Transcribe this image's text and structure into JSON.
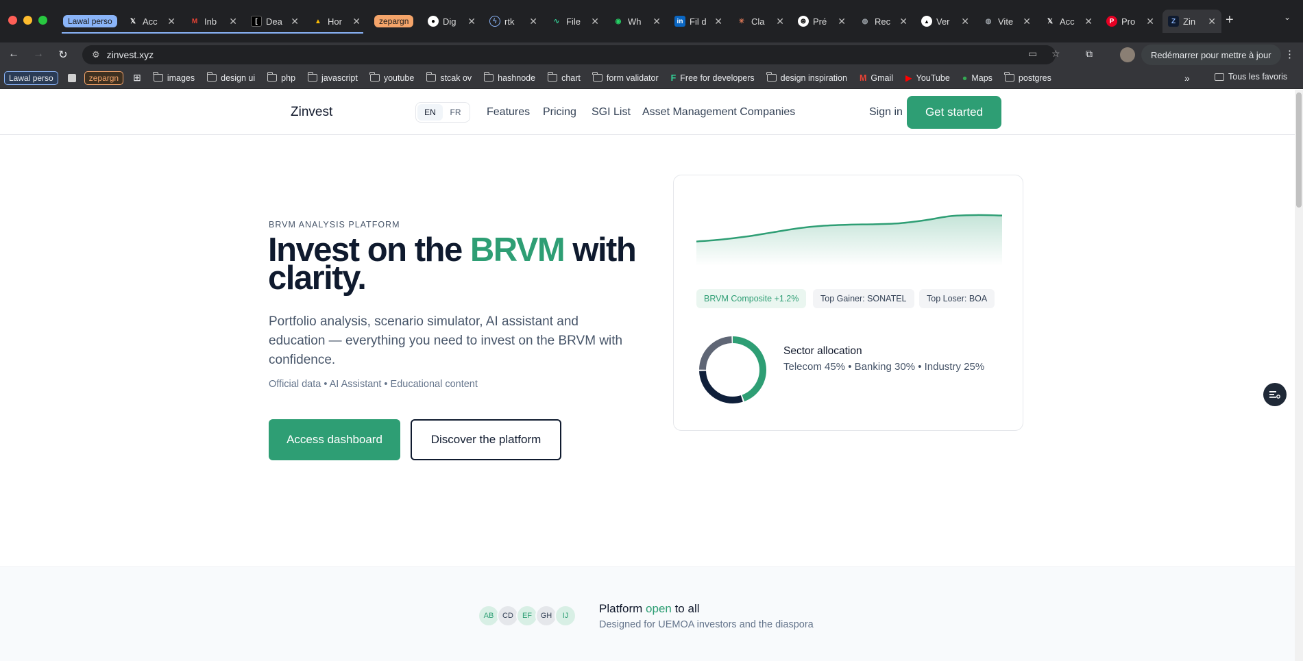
{
  "browser": {
    "tab_groups": [
      {
        "label": "Lawal perso",
        "color": "#8ab4f8",
        "text_color": "#1a1a1a"
      },
      {
        "label": "zepargn",
        "color": "#f4a46a",
        "text_color": "#1a1a1a"
      }
    ],
    "tabs": [
      {
        "title": "Acc",
        "icon": "x-icon"
      },
      {
        "title": "Inb",
        "icon": "gmail-icon"
      },
      {
        "title": "Dea",
        "icon": "bracket-icon"
      },
      {
        "title": "Hor",
        "icon": "drive-icon"
      },
      {
        "title": "Dig",
        "icon": "github-icon"
      },
      {
        "title": "rtk",
        "icon": "lightning-icon"
      },
      {
        "title": "File",
        "icon": "pulse-icon"
      },
      {
        "title": "Wh",
        "icon": "whatsapp-icon"
      },
      {
        "title": "Fil d",
        "icon": "linkedin-icon"
      },
      {
        "title": "Cla",
        "icon": "claude-icon"
      },
      {
        "title": "Pré",
        "icon": "openai-icon"
      },
      {
        "title": "Rec",
        "icon": "globe-icon"
      },
      {
        "title": "Ver",
        "icon": "vercel-icon"
      },
      {
        "title": "Vite",
        "icon": "globe-icon"
      },
      {
        "title": "Acc",
        "icon": "x-icon"
      },
      {
        "title": "Pro",
        "icon": "pinterest-icon"
      },
      {
        "title": "Zin",
        "icon": "zinvest-icon",
        "active": true
      }
    ],
    "url": "zinvest.xyz",
    "restart_label": "Redémarrer pour mettre à jour",
    "bookmarks": [
      {
        "label": "images",
        "type": "folder"
      },
      {
        "label": "design ui",
        "type": "folder"
      },
      {
        "label": "php",
        "type": "folder"
      },
      {
        "label": "javascript",
        "type": "folder"
      },
      {
        "label": "youtube",
        "type": "folder"
      },
      {
        "label": "stcak ov",
        "type": "folder"
      },
      {
        "label": "hashnode",
        "type": "folder"
      },
      {
        "label": "chart",
        "type": "folder"
      },
      {
        "label": "form validator",
        "type": "folder"
      },
      {
        "label": "Free for developers",
        "type": "link"
      },
      {
        "label": "design inspiration",
        "type": "folder"
      },
      {
        "label": "Gmail",
        "type": "link"
      },
      {
        "label": "YouTube",
        "type": "link"
      },
      {
        "label": "Maps",
        "type": "link"
      },
      {
        "label": "postgres",
        "type": "folder"
      }
    ],
    "all_bookmarks_label": "Tous les favoris"
  },
  "site": {
    "brand": "Zinvest",
    "lang": {
      "en": "EN",
      "fr": "FR",
      "active": "EN"
    },
    "nav": [
      "Features",
      "Pricing",
      "SGI List",
      "Asset Management Companies"
    ],
    "sign_in": "Sign in",
    "get_started": "Get started"
  },
  "hero": {
    "kicker": "BRVM ANALYSIS PLATFORM",
    "title_pre": "Invest on the ",
    "title_accent": "BRVM",
    "title_post": " with clarity.",
    "subtitle": "Portfolio analysis, scenario simulator, AI assistant and education — everything you need to invest on the BRVM with confidence.",
    "meta": "Official data • AI Assistant • Educational content",
    "primary_cta": "Access dashboard",
    "secondary_cta": "Discover the platform"
  },
  "card": {
    "chips": [
      {
        "label": "BRVM Composite +1.2%",
        "style": "green"
      },
      {
        "label": "Top Gainer: SONATEL",
        "style": "gray"
      },
      {
        "label": "Top Loser: BOA",
        "style": "gray"
      }
    ],
    "sector_title": "Sector allocation",
    "sector_text": "Telecom 45% • Banking 30% • Industry 25%"
  },
  "chart_data": [
    {
      "type": "line",
      "y": [
        10,
        14,
        20,
        28,
        36,
        41,
        43,
        44,
        46,
        52,
        60,
        62,
        61
      ],
      "color": "#2e9e74"
    },
    {
      "type": "pie",
      "categories": [
        "Telecom",
        "Banking",
        "Industry"
      ],
      "values": [
        45,
        30,
        25
      ],
      "colors": [
        "#2e9e74",
        "#0f1f3a",
        "#5f6675"
      ]
    }
  ],
  "band": {
    "avatars": [
      {
        "initials": "AB",
        "bg": "#d8efe5",
        "fg": "#2e9e74"
      },
      {
        "initials": "CD",
        "bg": "#e5e7eb",
        "fg": "#334155"
      },
      {
        "initials": "EF",
        "bg": "#d8efe5",
        "fg": "#2e9e74"
      },
      {
        "initials": "GH",
        "bg": "#e5e7eb",
        "fg": "#334155"
      },
      {
        "initials": "IJ",
        "bg": "#d8efe5",
        "fg": "#2e9e74"
      }
    ],
    "title_pre": "Platform ",
    "title_accent": "open",
    "title_post": " to all",
    "subtitle": "Designed for UEMOA investors and the diaspora"
  },
  "theme": {
    "accent": "#2e9e74",
    "navy": "#0f1a2e"
  }
}
